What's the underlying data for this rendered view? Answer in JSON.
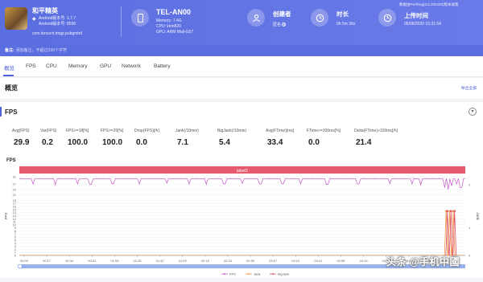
{
  "app": {
    "name": "和平精英",
    "android_version": "Android版本号: 1.7.7",
    "android_build": "Android版本号: 8500",
    "package": "com.tencent.tmgp.pubgmhd"
  },
  "device": {
    "name": "TEL-AN00",
    "memory": "Memory: 7.4G",
    "cpu": "CPU: kirin820",
    "gpu": "GPU: ARM Mali-G57"
  },
  "creator": {
    "title": "创建者",
    "value": "匿名"
  },
  "duration": {
    "title": "时长",
    "value": "0h 5m 36s"
  },
  "upload": {
    "title": "上传时间",
    "value": "05/06/2020 15:31:54"
  },
  "perfdog_version": "数据由PerfDog(3.6.200420)版本收集",
  "remark": {
    "label": "备注:",
    "placeholder": "添加备注，不超过200个字符"
  },
  "tabs": [
    "概览",
    "FPS",
    "CPU",
    "Memory",
    "GPU",
    "Network",
    "Battery"
  ],
  "overview": {
    "title": "概览",
    "export_label": "导出全部"
  },
  "fps_section": {
    "title": "FPS",
    "toggle": "▾"
  },
  "metrics": [
    {
      "label": "Avg(FPS)",
      "value": "29.9"
    },
    {
      "label": "Var(FPS)",
      "value": "0.2"
    },
    {
      "label": "FPS>=18[%]",
      "value": "100.0"
    },
    {
      "label": "FPS>=25[%]",
      "value": "100.0"
    },
    {
      "label": "Drop(FPS)[/h]",
      "value": "0.0"
    },
    {
      "label": "Jank(/10min)",
      "value": "7.1"
    },
    {
      "label": "BigJank(/10min)",
      "value": "5.4"
    },
    {
      "label": "Avg(FTime)[ms]",
      "value": "33.4"
    },
    {
      "label": "FTime>=100ms[%]",
      "value": "0.0"
    },
    {
      "label": "Delta(FTime)>100ms[/h]",
      "value": "21.4"
    }
  ],
  "watermark": "头条 @手机中國",
  "colors": {
    "accent": "#4d62d8",
    "fps": "#c25ac7",
    "jank": "#f29a4a",
    "bigjank": "#e0556a",
    "label_band": "#e65a6e"
  },
  "chart_data": {
    "type": "line",
    "title": "FPS",
    "band_label": "label1",
    "y_left_ticks": [
      0,
      1,
      2,
      3,
      4,
      5,
      6,
      7,
      8,
      9,
      10,
      11,
      12,
      13,
      14,
      15,
      16,
      17,
      18,
      21,
      24,
      27,
      31
    ],
    "y_right_ticks": [
      0,
      1,
      2
    ],
    "ylabel_left": "FPS",
    "ylabel_right": "Jank",
    "x_ticks": [
      "00:00",
      "00:17",
      "00:34",
      "00:51",
      "01:08",
      "01:25",
      "01:42",
      "01:59",
      "02:16",
      "02:33",
      "02:50",
      "03:07",
      "03:24",
      "03:41",
      "03:58",
      "04:15",
      "04:32",
      "04:49",
      "05:06",
      "05:23"
    ],
    "legend": [
      "FPS",
      "Jank",
      "BigJank"
    ],
    "series": [
      {
        "name": "FPS",
        "base": 29.9,
        "dips": [
          [
            0.03,
            27
          ],
          [
            0.08,
            26.5
          ],
          [
            0.13,
            27
          ],
          [
            0.16,
            26.8
          ],
          [
            0.21,
            27.2
          ],
          [
            0.27,
            27
          ],
          [
            0.33,
            27.5
          ],
          [
            0.38,
            27
          ],
          [
            0.42,
            26.8
          ],
          [
            0.46,
            27
          ],
          [
            0.5,
            27.3
          ],
          [
            0.54,
            27
          ],
          [
            0.59,
            27.2
          ],
          [
            0.63,
            27
          ],
          [
            0.69,
            26.8
          ],
          [
            0.76,
            27
          ],
          [
            0.83,
            27.2
          ],
          [
            0.88,
            27
          ],
          [
            0.9,
            26.5
          ],
          [
            0.955,
            25
          ],
          [
            0.962,
            24
          ],
          [
            0.97,
            26
          ],
          [
            0.98,
            27
          ],
          [
            0.99,
            25
          ]
        ]
      },
      {
        "name": "Jank",
        "spikes": [
          0.957,
          0.965,
          0.973
        ]
      },
      {
        "name": "BigJank",
        "spikes": [
          0.96,
          0.968,
          0.976
        ]
      }
    ]
  }
}
